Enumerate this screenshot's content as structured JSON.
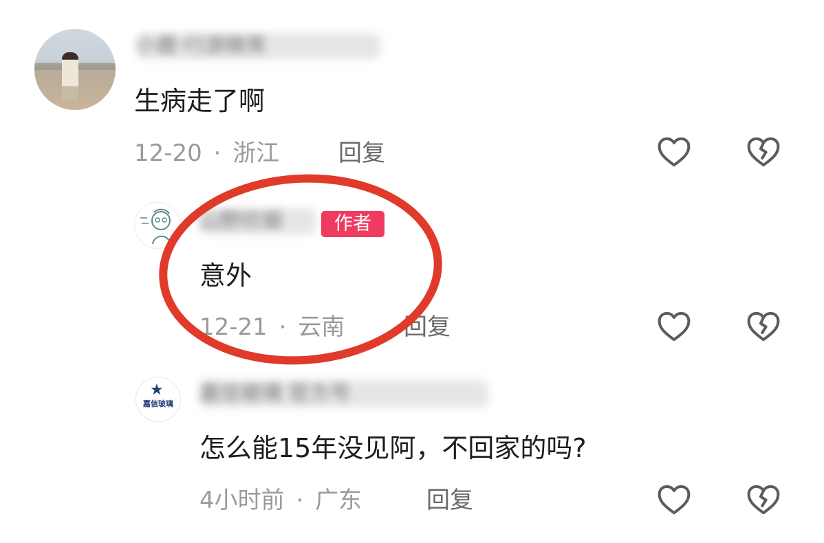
{
  "comments": [
    {
      "username": "小鹿·行游微笑",
      "text": "生病走了啊",
      "date": "12-20",
      "location": "浙江",
      "reply_label": "回复",
      "like_icon": "heart-outline-icon",
      "dislike_icon": "broken-heart-icon"
    },
    {
      "username": "山野炊烟",
      "author_badge": "作者",
      "text": "意外",
      "date": "12-21",
      "location": "云南",
      "reply_label": "回复",
      "like_icon": "heart-outline-icon",
      "dislike_icon": "broken-heart-icon"
    },
    {
      "username": "嘉信玻璃 官方号",
      "avatar_label": "嘉信玻璃",
      "text": "怎么能15年没见阿，不回家的吗?",
      "date": "4小时前",
      "location": "广东",
      "reply_label": "回复",
      "like_icon": "heart-outline-icon",
      "dislike_icon": "broken-heart-icon"
    }
  ],
  "separator": "·",
  "colors": {
    "author_badge_bg": "#ef3b5f",
    "highlight_circle": "#e03a2a",
    "meta_text": "#9a9a9a",
    "primary_text": "#1d1d1d"
  }
}
